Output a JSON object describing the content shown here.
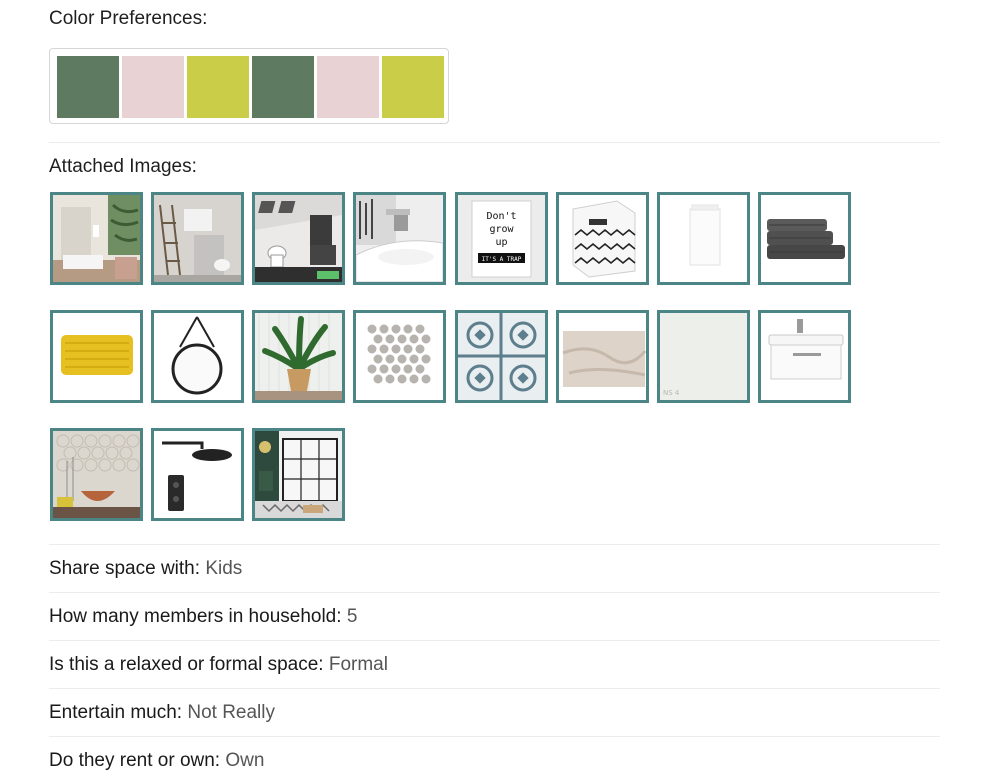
{
  "color_preferences": {
    "label": "Color Preferences:",
    "swatches": [
      "#5e7a60",
      "#e8d2d4",
      "#c9cd47",
      "#5e7a60",
      "#e8d2d4",
      "#c9cd47"
    ]
  },
  "attached_images": {
    "label": "Attached Images:",
    "accent_border": "#4b8585",
    "items": [
      "bathroom-tropical-wallpaper-photo",
      "bathroom-shelf-ladder-photo",
      "bathroom-skylight-photo",
      "sink-faucet-photo",
      "dont-grow-up-poster",
      "zigzag-storage-box",
      "white-cabinet",
      "grey-towels",
      "yellow-bath-mat",
      "round-hanging-mirror",
      "potted-plant",
      "hexagon-mosaic-tile",
      "patterned-floor-tile",
      "marble-tile",
      "white-tile-sample",
      "wall-hung-vanity-unit",
      "hexagon-wall-tile-bowl",
      "black-rain-shower",
      "black-framed-shower-screen"
    ],
    "poster_text": [
      "Don't",
      "grow",
      "up",
      "IT'S A TRAP"
    ],
    "tile_caption": "NS 4"
  },
  "details": [
    {
      "key": "Share space with:",
      "value": "Kids"
    },
    {
      "key": "How many members in household:",
      "value": "5"
    },
    {
      "key": "Is this a relaxed or formal space:",
      "value": "Formal"
    },
    {
      "key": "Entertain much:",
      "value": "Not Really"
    },
    {
      "key": "Do they rent or own:",
      "value": "Own"
    }
  ]
}
